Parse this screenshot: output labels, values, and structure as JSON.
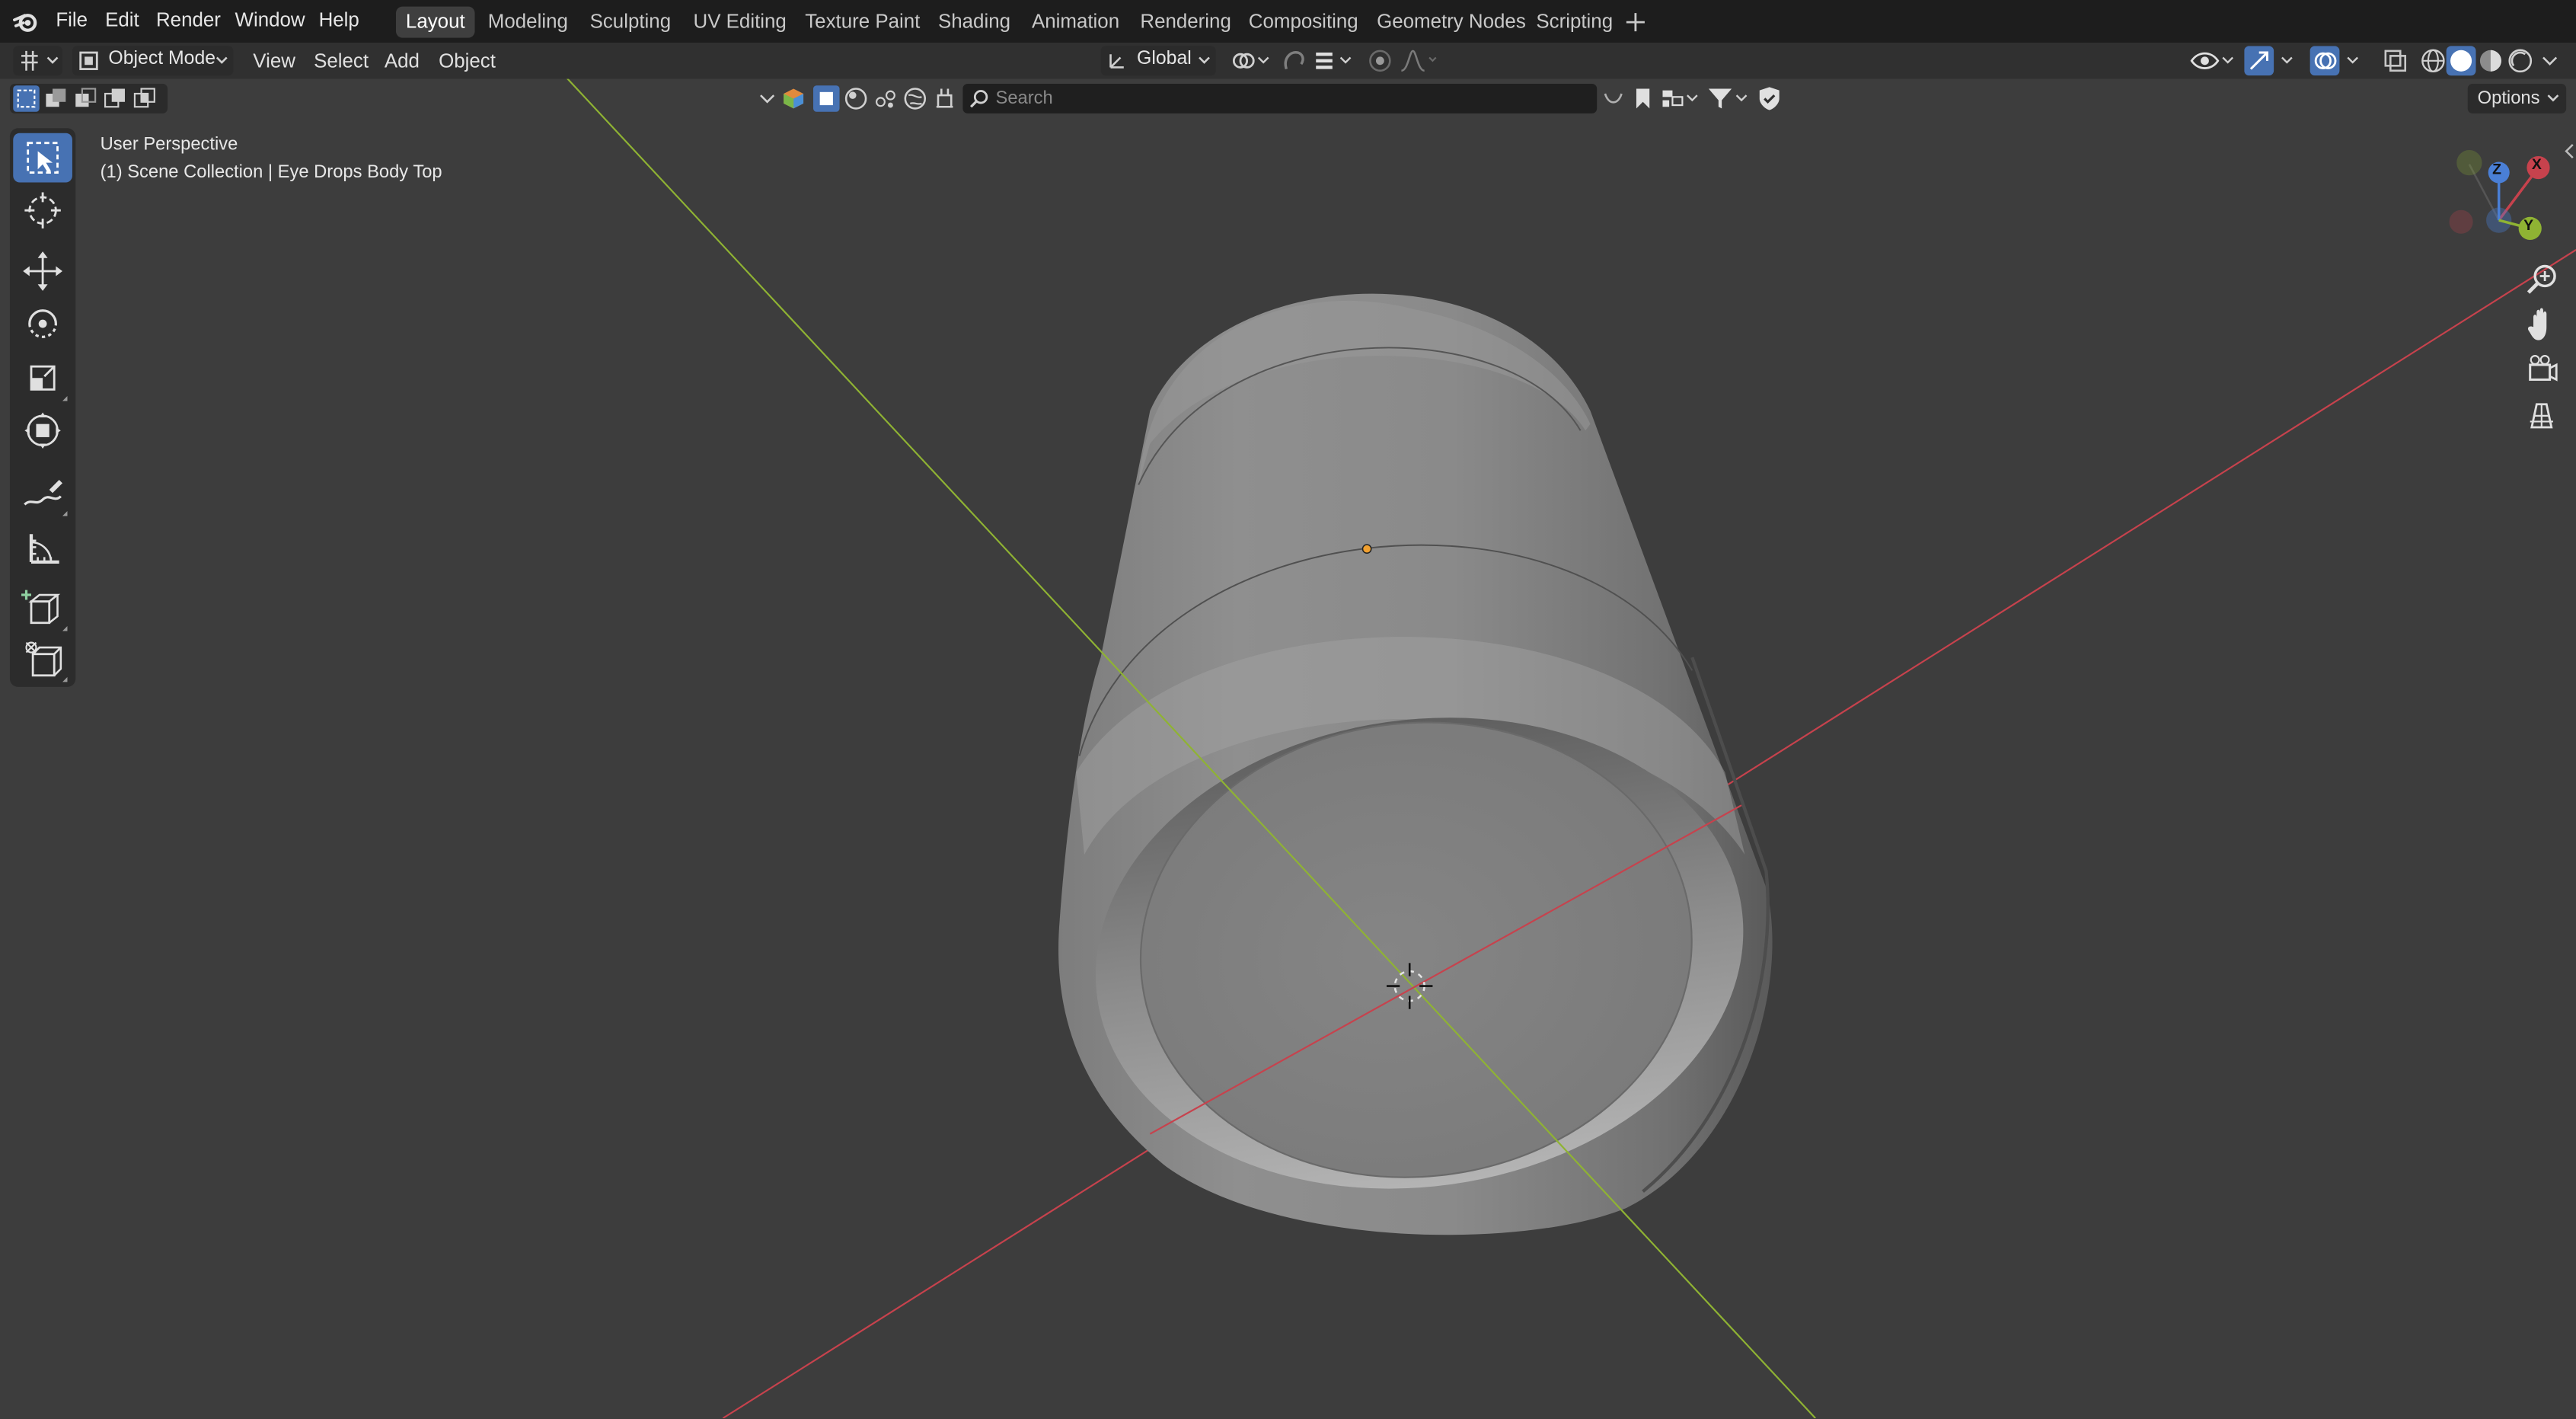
{
  "app": {
    "logo_icon": "blender-logo-icon"
  },
  "menus": [
    "File",
    "Edit",
    "Render",
    "Window",
    "Help"
  ],
  "workspaces": [
    "Layout",
    "Modeling",
    "Sculpting",
    "UV Editing",
    "Texture Paint",
    "Shading",
    "Animation",
    "Rendering",
    "Compositing",
    "Geometry Nodes",
    "Scripting"
  ],
  "active_workspace": "Layout",
  "add_workspace_icon": "plus-icon",
  "header": {
    "mode": "Object Mode",
    "view": "View",
    "select": "Select",
    "add": "Add",
    "object": "Object",
    "orientation": "Global"
  },
  "search": {
    "placeholder": "Search",
    "value": ""
  },
  "options_label": "Options",
  "viewport": {
    "perspective_label": "User Perspective",
    "collection_label": "(1) Scene Collection | Eye Drops Body Top"
  },
  "gizmo": {
    "x": "X",
    "y": "Y",
    "z": "Z"
  },
  "tools": [
    "select-box-icon",
    "cursor-icon",
    "move-icon",
    "rotate-icon",
    "scale-icon",
    "transform-icon",
    "annotate-icon",
    "measure-icon",
    "add-cube-icon",
    "extrude-icon"
  ],
  "colors": {
    "accent": "#4772b3",
    "x_axis": "#c7424d",
    "y_axis": "#8fb333",
    "z_axis": "#4a7fd6",
    "background": "#3d3d3d"
  }
}
